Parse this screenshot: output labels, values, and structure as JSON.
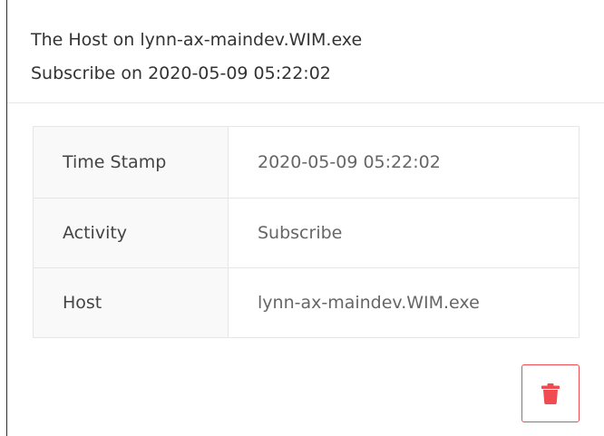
{
  "header": {
    "title_line": "The Host on lynn-ax-maindev.WIM.exe",
    "subtitle_line": "Subscribe on 2020-05-09 05:22:02"
  },
  "details": [
    {
      "label": "Time Stamp",
      "value": "2020-05-09 05:22:02"
    },
    {
      "label": "Activity",
      "value": "Subscribe"
    },
    {
      "label": "Host",
      "value": "lynn-ax-maindev.WIM.exe"
    }
  ],
  "actions": {
    "delete_icon": "trash-icon",
    "accent_color": "#ef4b50"
  }
}
